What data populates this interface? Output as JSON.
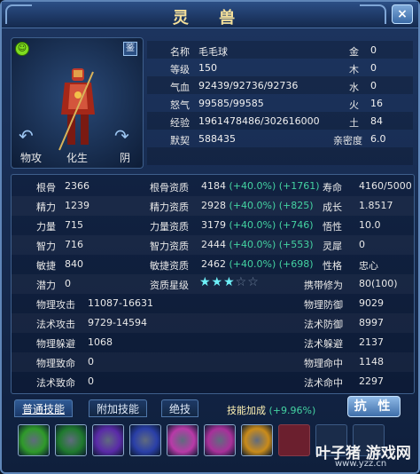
{
  "window": {
    "title": "灵 兽",
    "close_label": "×"
  },
  "portrait": {
    "jian_label": "鉴",
    "buttons": [
      "物攻",
      "化生",
      "阴"
    ]
  },
  "info": [
    {
      "label": "名称",
      "value": "毛毛球",
      "elem_label": "金",
      "elem_value": "0"
    },
    {
      "label": "等级",
      "value": "150",
      "elem_label": "木",
      "elem_value": "0"
    },
    {
      "label": "气血",
      "value": "92439/92736/92736",
      "elem_label": "水",
      "elem_value": "0"
    },
    {
      "label": "怒气",
      "value": "99585/99585",
      "elem_label": "火",
      "elem_value": "16"
    },
    {
      "label": "经验",
      "value": "1961478486/302616000",
      "elem_label": "土",
      "elem_value": "84"
    },
    {
      "label": "默契",
      "value": "588435",
      "elem_label": "亲密度",
      "elem_value": "6.0"
    }
  ],
  "stats": {
    "r1": {
      "l1": "根骨",
      "v1": "2366",
      "l2": "根骨资质",
      "v2": "4184",
      "g2": "(+40.0%) (+1761)",
      "l3": "寿命",
      "v3": "4160/5000"
    },
    "r2": {
      "l1": "精力",
      "v1": "1239",
      "l2": "精力资质",
      "v2": "2928",
      "g2": "(+40.0%) (+825)",
      "l3": "成长",
      "v3": "1.8517"
    },
    "r3": {
      "l1": "力量",
      "v1": "715",
      "l2": "力量资质",
      "v2": "3179",
      "g2": "(+40.0%) (+746)",
      "l3": "悟性",
      "v3": "10.0"
    },
    "r4": {
      "l1": "智力",
      "v1": "716",
      "l2": "智力资质",
      "v2": "2444",
      "g2": "(+40.0%) (+553)",
      "l3": "灵犀",
      "v3": "0"
    },
    "r5": {
      "l1": "敏捷",
      "v1": "840",
      "l2": "敏捷资质",
      "v2": "2462",
      "g2": "(+40.0%) (+698)",
      "l3": "性格",
      "v3": "忠心"
    },
    "r6": {
      "l1": "潜力",
      "v1": "0",
      "l2": "资质星级",
      "stars_on": "★★★",
      "stars_off": "☆☆",
      "stars_count": 3,
      "l3": "携带修为",
      "v3": "80(100)"
    },
    "r7": {
      "l1": "物理攻击",
      "v1": "11087-16631",
      "l3": "物理防御",
      "v3": "9029"
    },
    "r8": {
      "l1": "法术攻击",
      "v1": "9729-14594",
      "l3": "法术防御",
      "v3": "8997"
    },
    "r9": {
      "l1": "物理躲避",
      "v1": "1068",
      "l3": "法术躲避",
      "v3": "2137"
    },
    "r10": {
      "l1": "物理致命",
      "v1": "0",
      "l3": "物理命中",
      "v3": "1148"
    },
    "r11": {
      "l1": "法术致命",
      "v1": "0",
      "l3": "法术命中",
      "v3": "2297"
    }
  },
  "tabs": {
    "t1": "普通技能",
    "t2": "附加技能",
    "t3": "绝技"
  },
  "bonus": {
    "label": "技能加成",
    "value": "(+9.96%)"
  },
  "kangxing_label": "抗 性",
  "skills": [
    {
      "name": "green-swirl-skill",
      "color": "#2f9a2a"
    },
    {
      "name": "green-spiral-skill",
      "color": "#1f7a2e"
    },
    {
      "name": "purple-claw-skill",
      "color": "#5a2aa8"
    },
    {
      "name": "blue-shard-skill",
      "color": "#2a3fa8"
    },
    {
      "name": "pink-burst-skill",
      "color": "#b83aa8"
    },
    {
      "name": "magenta-star-skill",
      "color": "#a8309a"
    },
    {
      "name": "gold-crescent-skill",
      "color": "#c98b1a"
    }
  ],
  "watermark": {
    "logo": "叶子猪 游戏网",
    "url": "www.yzz.cn"
  }
}
